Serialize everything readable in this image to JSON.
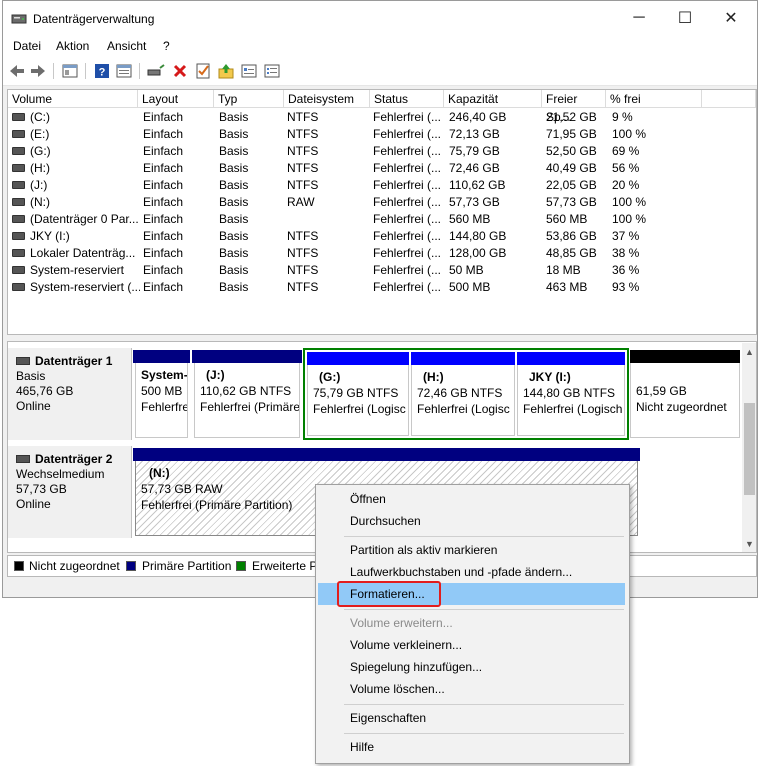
{
  "window": {
    "title": "Datenträgerverwaltung",
    "controls": {
      "minimize": "─",
      "maximize": "☐",
      "close": "✕"
    }
  },
  "menu": [
    "Datei",
    "Aktion",
    "Ansicht",
    "?"
  ],
  "volume_table": {
    "columns": [
      "Volume",
      "Layout",
      "Typ",
      "Dateisystem",
      "Status",
      "Kapazität",
      "Freier Sp...",
      "% frei"
    ],
    "rows": [
      {
        "volume": "(C:)",
        "layout": "Einfach",
        "typ": "Basis",
        "fs": "NTFS",
        "status": "Fehlerfrei (...",
        "cap": "246,40 GB",
        "free": "21,52 GB",
        "pct": "9 %"
      },
      {
        "volume": "(E:)",
        "layout": "Einfach",
        "typ": "Basis",
        "fs": "NTFS",
        "status": "Fehlerfrei (...",
        "cap": "72,13 GB",
        "free": "71,95 GB",
        "pct": "100 %"
      },
      {
        "volume": "(G:)",
        "layout": "Einfach",
        "typ": "Basis",
        "fs": "NTFS",
        "status": "Fehlerfrei (...",
        "cap": "75,79 GB",
        "free": "52,50 GB",
        "pct": "69 %"
      },
      {
        "volume": "(H:)",
        "layout": "Einfach",
        "typ": "Basis",
        "fs": "NTFS",
        "status": "Fehlerfrei (...",
        "cap": "72,46 GB",
        "free": "40,49 GB",
        "pct": "56 %"
      },
      {
        "volume": "(J:)",
        "layout": "Einfach",
        "typ": "Basis",
        "fs": "NTFS",
        "status": "Fehlerfrei (...",
        "cap": "110,62 GB",
        "free": "22,05 GB",
        "pct": "20 %"
      },
      {
        "volume": "(N:)",
        "layout": "Einfach",
        "typ": "Basis",
        "fs": "RAW",
        "status": "Fehlerfrei (...",
        "cap": "57,73 GB",
        "free": "57,73 GB",
        "pct": "100 %"
      },
      {
        "volume": "(Datenträger 0 Par...",
        "layout": "Einfach",
        "typ": "Basis",
        "fs": "",
        "status": "Fehlerfrei (...",
        "cap": "560 MB",
        "free": "560 MB",
        "pct": "100 %"
      },
      {
        "volume": "JKY (I:)",
        "layout": "Einfach",
        "typ": "Basis",
        "fs": "NTFS",
        "status": "Fehlerfrei (...",
        "cap": "144,80 GB",
        "free": "53,86 GB",
        "pct": "37 %"
      },
      {
        "volume": "Lokaler Datenträg...",
        "layout": "Einfach",
        "typ": "Basis",
        "fs": "NTFS",
        "status": "Fehlerfrei (...",
        "cap": "128,00 GB",
        "free": "48,85 GB",
        "pct": "38 %"
      },
      {
        "volume": "System-reserviert",
        "layout": "Einfach",
        "typ": "Basis",
        "fs": "NTFS",
        "status": "Fehlerfrei (...",
        "cap": "50 MB",
        "free": "18 MB",
        "pct": "36 %"
      },
      {
        "volume": "System-reserviert (...",
        "layout": "Einfach",
        "typ": "Basis",
        "fs": "NTFS",
        "status": "Fehlerfrei (...",
        "cap": "500 MB",
        "free": "463 MB",
        "pct": "93 %"
      }
    ]
  },
  "disks": [
    {
      "name": "Datenträger 1",
      "type": "Basis",
      "size": "465,76 GB",
      "state": "Online",
      "partitions": [
        {
          "title": "System-",
          "line1": "500 MB",
          "line2": "Fehlerfrei"
        },
        {
          "title": "(J:)",
          "line1": "110,62 GB NTFS",
          "line2": "Fehlerfrei (Primäre"
        },
        {
          "title": "(G:)",
          "line1": "75,79 GB NTFS",
          "line2": "Fehlerfrei (Logisc"
        },
        {
          "title": "(H:)",
          "line1": "72,46 GB NTFS",
          "line2": "Fehlerfrei (Logisc"
        },
        {
          "title": "JKY (I:)",
          "line1": "144,80 GB NTFS",
          "line2": "Fehlerfrei (Logisch"
        },
        {
          "title": "",
          "line1": "61,59 GB",
          "line2": "Nicht zugeordnet"
        }
      ]
    },
    {
      "name": "Datenträger 2",
      "type": "Wechselmedium",
      "size": "57,73 GB",
      "state": "Online",
      "partitions": [
        {
          "title": "(N:)",
          "line1": "57,73 GB RAW",
          "line2": "Fehlerfrei (Primäre Partition)"
        }
      ]
    }
  ],
  "legend": [
    {
      "label": "Nicht zugeordnet",
      "color": "#000000"
    },
    {
      "label": "Primäre Partition",
      "color": "#000080"
    },
    {
      "label": "Erweiterte Pa",
      "color": "#008000"
    }
  ],
  "context_menu": {
    "items": [
      "Öffnen",
      "Durchsuchen",
      "Partition als aktiv markieren",
      "Laufwerkbuchstaben und -pfade ändern...",
      "Formatieren...",
      "Volume erweitern...",
      "Volume verkleinern...",
      "Spiegelung hinzufügen...",
      "Volume löschen...",
      "Eigenschaften",
      "Hilfe"
    ],
    "highlighted": "Formatieren...",
    "disabled": [
      "Volume erweitern..."
    ]
  },
  "colors": {
    "primary": "#000080",
    "logical": "#0000ff",
    "unallocated": "#000000",
    "extended_border": "#008000",
    "highlight": "#91c9f7",
    "callout": "#e21d1d"
  }
}
